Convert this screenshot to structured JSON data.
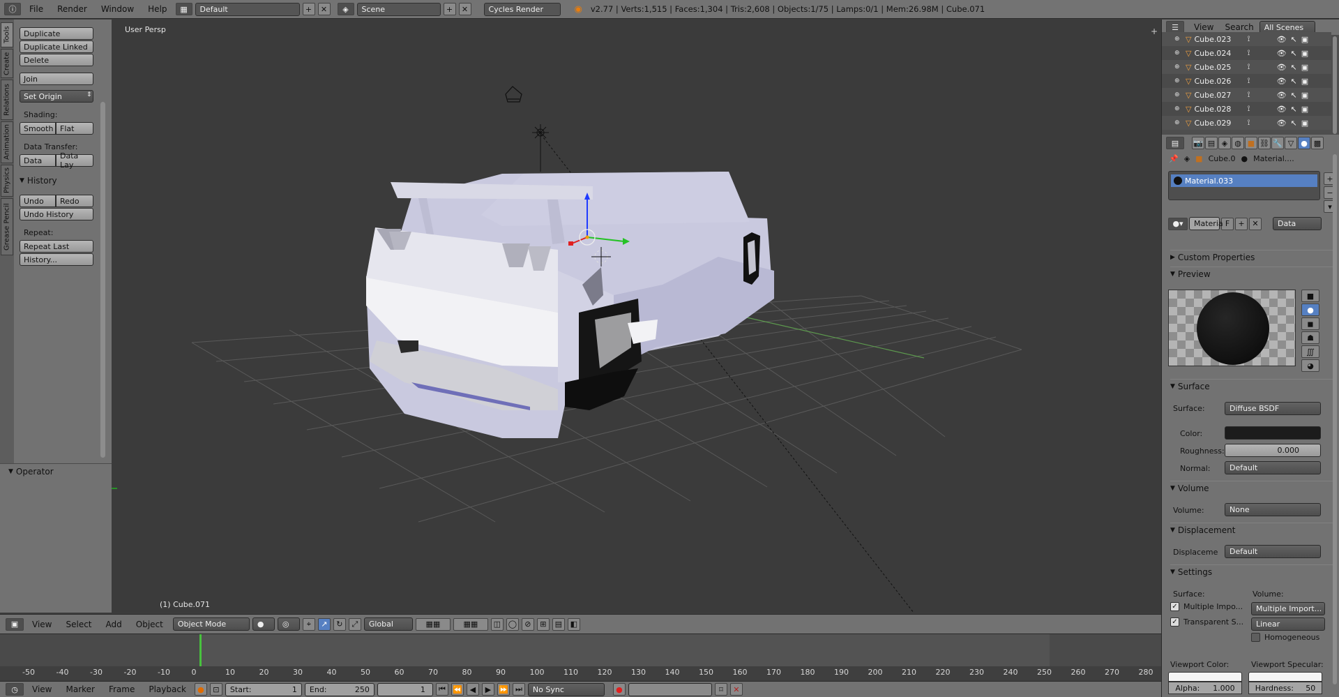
{
  "topbar": {
    "info_icon": "info-icon",
    "menus": [
      "File",
      "Render",
      "Window",
      "Help"
    ],
    "layout": "Default",
    "scene": "Scene",
    "engine": "Cycles Render",
    "stats": "v2.77 | Verts:1,515 | Faces:1,304 | Tris:2,608 | Objects:1/75 | Lamps:0/1 | Mem:26.98M | Cube.071"
  },
  "vtabs": [
    "Tools",
    "Create",
    "Relations",
    "Animation",
    "Physics",
    "Grease Pencil"
  ],
  "tools": {
    "duplicate": "Duplicate",
    "duplicate_linked": "Duplicate Linked",
    "delete": "Delete",
    "join": "Join",
    "set_origin": "Set Origin",
    "shading_label": "Shading:",
    "smooth": "Smooth",
    "flat": "Flat",
    "data_transfer_label": "Data Transfer:",
    "data": "Data",
    "data_lay": "Data Lay",
    "history_header": "History",
    "undo": "Undo",
    "redo": "Redo",
    "undo_history": "Undo History",
    "repeat_label": "Repeat:",
    "repeat_last": "Repeat Last",
    "history_ellipsis": "History...",
    "operator_header": "Operator"
  },
  "viewport": {
    "view_name": "User Persp",
    "object_label": "(1) Cube.071"
  },
  "view3d_header": {
    "menus": [
      "View",
      "Select",
      "Add",
      "Object"
    ],
    "mode": "Object Mode",
    "orientation": "Global"
  },
  "timeline": {
    "ticks": [
      "-50",
      "-40",
      "-30",
      "-20",
      "-10",
      "0",
      "10",
      "20",
      "30",
      "40",
      "50",
      "60",
      "70",
      "80",
      "90",
      "100",
      "110",
      "120",
      "130",
      "140",
      "150",
      "160",
      "170",
      "180",
      "190",
      "200",
      "210",
      "220",
      "230",
      "240",
      "250",
      "260",
      "270",
      "280"
    ],
    "menus": [
      "View",
      "Marker",
      "Frame",
      "Playback"
    ],
    "start_label": "Start:",
    "start_value": "1",
    "end_label": "End:",
    "end_value": "250",
    "current_frame": "1",
    "sync": "No Sync"
  },
  "outliner": {
    "view": "View",
    "search": "Search",
    "scenes": "All Scenes",
    "items": [
      "Cube.023",
      "Cube.024",
      "Cube.025",
      "Cube.026",
      "Cube.027",
      "Cube.028",
      "Cube.029"
    ]
  },
  "properties": {
    "breadcrumb_object": "Cube.0",
    "breadcrumb_material": "Material....",
    "material_slot": "Material.033",
    "material_field": "Materia",
    "f_label": "F",
    "data_select": "Data",
    "custom_properties": "Custom Properties",
    "preview": "Preview",
    "surface_header": "Surface",
    "surface_label": "Surface:",
    "surface_value": "Diffuse BSDF",
    "color_label": "Color:",
    "roughness_label": "Roughness:",
    "roughness_value": "0.000",
    "normal_label": "Normal:",
    "normal_value": "Default",
    "volume_header": "Volume",
    "volume_label": "Volume:",
    "volume_value": "None",
    "displacement_header": "Displacement",
    "displacement_label": "Displaceme",
    "displacement_value": "Default",
    "settings_header": "Settings",
    "settings_surface": "Surface:",
    "settings_volume": "Volume:",
    "multiple_impo": "Multiple Impo...",
    "multiple_import": "Multiple Import...",
    "transparent_s": "Transparent S...",
    "linear": "Linear",
    "homogeneous": "Homogeneous",
    "viewport_color": "Viewport Color:",
    "viewport_specular": "Viewport Specular:",
    "alpha_label": "Alpha:",
    "alpha_value": "1.000",
    "hardness_label": "Hardness:",
    "hardness_value": "50"
  },
  "colors": {
    "header": "#727272",
    "viewport_bg": "#3b3b3b",
    "selected": "#5680c2",
    "car_body": "#c9c9df",
    "frame_marker": "#48c23e"
  }
}
